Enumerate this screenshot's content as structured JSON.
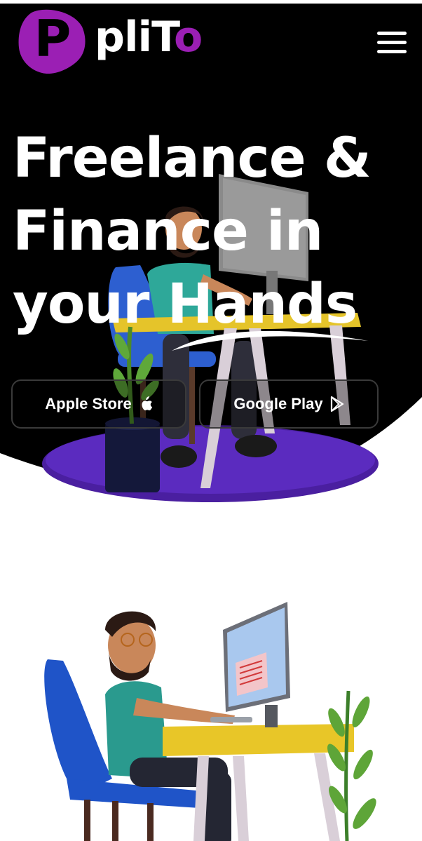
{
  "brand": {
    "mark_letter": "P",
    "name_prefix": "pliT",
    "name_suffix": "o",
    "brand_color": "#9b1fb4"
  },
  "nav": {
    "menu_icon": "hamburger-menu-icon"
  },
  "hero": {
    "headline_lines": [
      "Freelance &",
      "Finance in",
      "your Hands"
    ],
    "background_color": "#000000"
  },
  "store_buttons": {
    "apple": {
      "label": "Apple Store",
      "icon": "apple-icon"
    },
    "google": {
      "label": "Google Play",
      "icon": "play-icon"
    }
  },
  "illustrations": {
    "hero_image": "freelancer-at-desk-illustration",
    "feature_image": "freelancer-at-computer-illustration"
  }
}
